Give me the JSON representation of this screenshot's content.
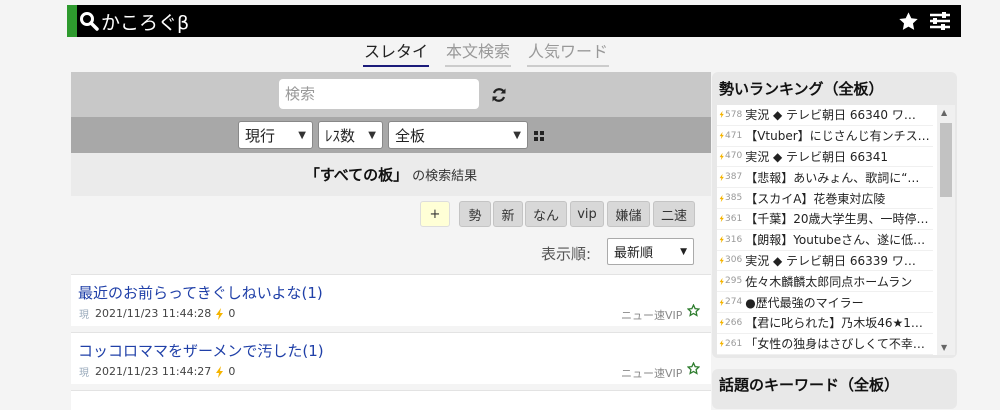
{
  "header": {
    "logo_text": "かころぐβ"
  },
  "tabs": [
    {
      "label": "スレタイ",
      "active": true
    },
    {
      "label": "本文検索",
      "active": false
    },
    {
      "label": "人気ワード",
      "active": false
    }
  ],
  "search": {
    "placeholder": "検索"
  },
  "filters": {
    "mode": "現行",
    "sort_key": "ﾚｽ数",
    "board": "全板"
  },
  "result": {
    "board": "「すべての板」",
    "suffix": "の検索結果"
  },
  "filter_buttons": [
    "+",
    "勢",
    "新",
    "なん",
    "vip",
    "嫌儲",
    "二速"
  ],
  "sort": {
    "label": "表示順:",
    "value": "最新順"
  },
  "threads": [
    {
      "title": "最近のお前らってきぐしねいよな(1)",
      "tag": "現",
      "datetime": "2021/11/23 11:44:28",
      "count": "0",
      "board": "ニュー速VIP"
    },
    {
      "title": "コッコロママをザーメンで汚した(1)",
      "tag": "現",
      "datetime": "2021/11/23 11:44:27",
      "count": "0",
      "board": "ニュー速VIP"
    }
  ],
  "ranking": {
    "title": "勢いランキング（全板）",
    "items": [
      {
        "num": "578",
        "text": "実況 ◆ テレビ朝日 66340 ワ…"
      },
      {
        "num": "471",
        "text": "【Vtuber】にじさんじ有ンチス…"
      },
      {
        "num": "470",
        "text": "実況 ◆ テレビ朝日 66341"
      },
      {
        "num": "387",
        "text": "【悲報】あいみょん、歌詞に“…"
      },
      {
        "num": "385",
        "text": "【スカイA】花巻東対広陵"
      },
      {
        "num": "361",
        "text": "【千葉】20歳大学生男、一時停…"
      },
      {
        "num": "316",
        "text": "【朗報】Youtubeさん、遂に低…"
      },
      {
        "num": "306",
        "text": "実況 ◆ テレビ朝日 66339 ワ…"
      },
      {
        "num": "295",
        "text": "佐々木麟麟太郎同点ホームラン"
      },
      {
        "num": "274",
        "text": "●歴代最強のマイラー"
      },
      {
        "num": "266",
        "text": "【君に叱られた】乃木坂46★1…"
      },
      {
        "num": "261",
        "text": "「女性の独身はさびしくて不幸…"
      }
    ]
  },
  "keywords": {
    "title": "話題のキーワード（全板）"
  },
  "colors": {
    "accent": "#2e9a2e",
    "link": "#2040a8",
    "bolt": "#f5b400"
  }
}
